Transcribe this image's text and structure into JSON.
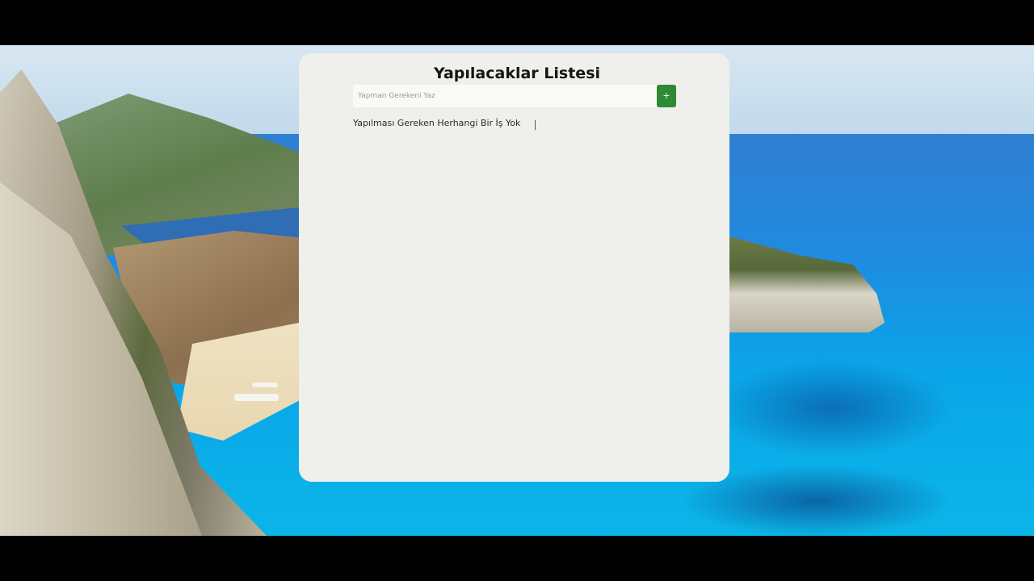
{
  "app": {
    "title": "Yapılacaklar Listesi",
    "input": {
      "placeholder": "Yapman Gerekeni Yaz",
      "value": ""
    },
    "add_button_label": "+",
    "empty_message": "Yapılması Gereken Herhangi Bir İş Yok"
  },
  "colors": {
    "accent": "#2f8a36",
    "card_background": "#efefec",
    "frame": "#000000"
  },
  "icons": {
    "cursor": "text-cursor-icon"
  }
}
